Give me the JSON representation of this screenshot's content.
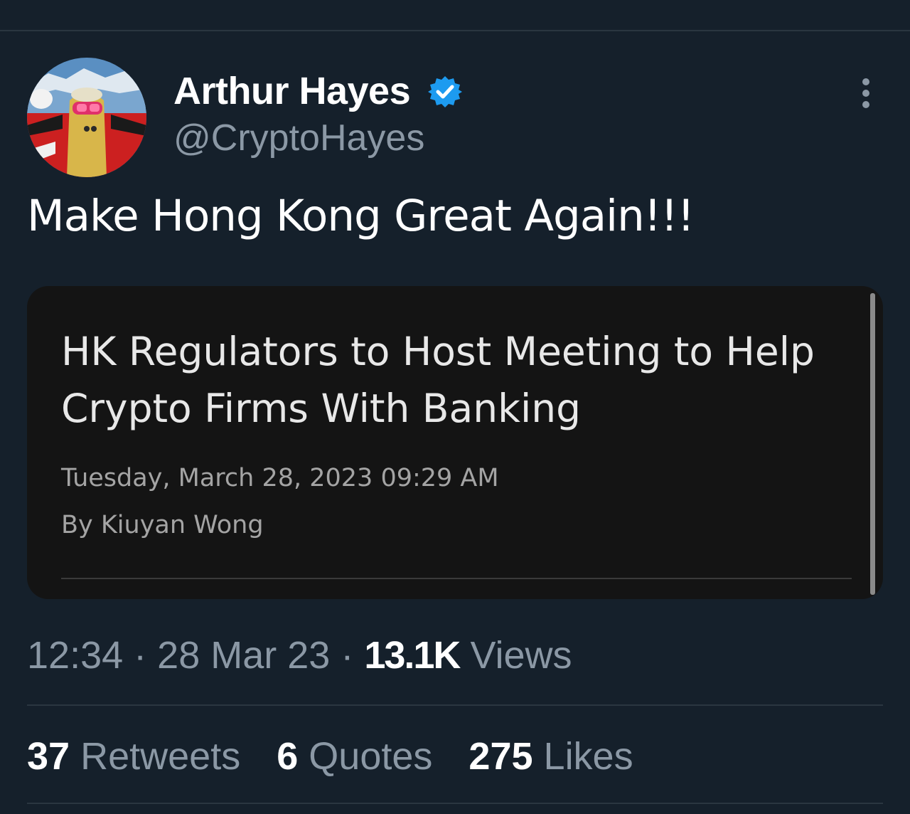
{
  "tweet": {
    "author_name": "Arthur Hayes",
    "author_handle": "@CryptoHayes",
    "verified_icon": "verified-badge-icon",
    "more_icon": "more-vertical-icon",
    "text": "Make Hong Kong Great Again!!!",
    "time": "12:34",
    "date": "28 Mar 23",
    "views_count": "13.1K",
    "views_label": "Views",
    "separator": "·"
  },
  "article": {
    "title": "HK Regulators to Host Meeting to Help Crypto Firms With Banking",
    "date": "Tuesday, March 28, 2023 09:29 AM",
    "byline": "By Kiuyan Wong"
  },
  "stats": {
    "retweets_count": "37",
    "retweets_label": "Retweets",
    "quotes_count": "6",
    "quotes_label": "Quotes",
    "likes_count": "275",
    "likes_label": "Likes"
  },
  "colors": {
    "background": "#15202b",
    "secondary_text": "#8b98a5",
    "verified_blue": "#1d9bf0",
    "card_background": "#141414"
  }
}
